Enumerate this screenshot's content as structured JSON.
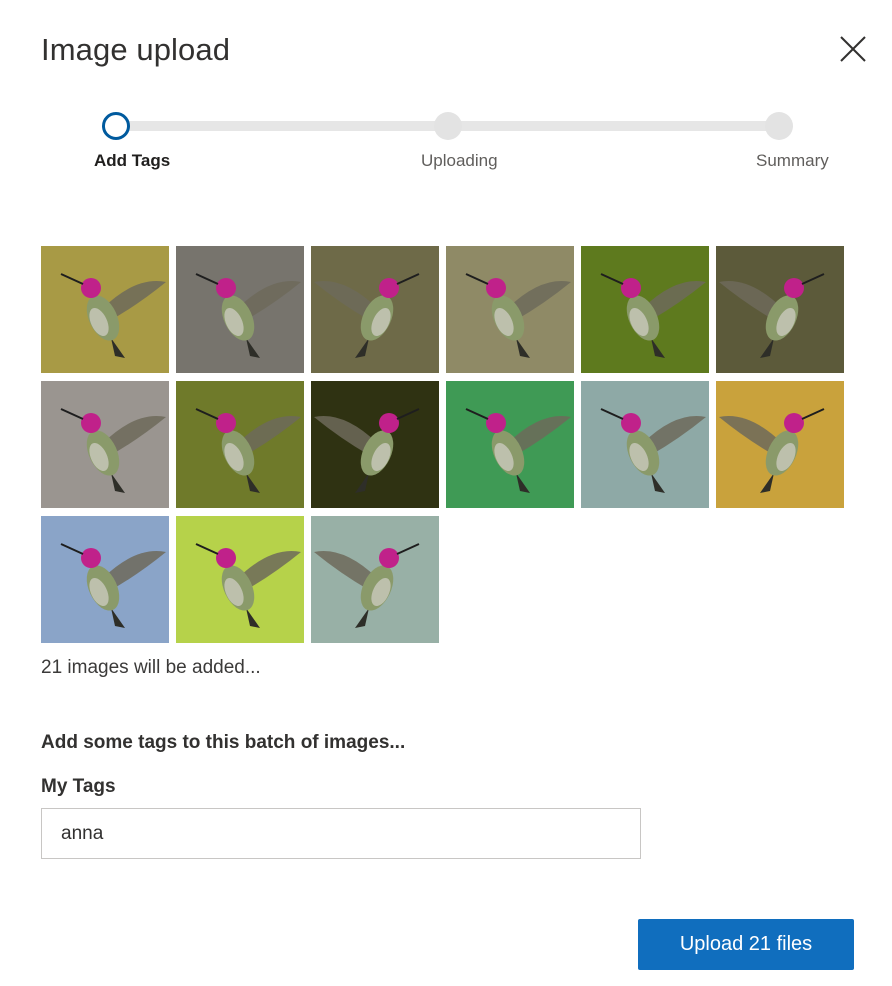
{
  "dialog": {
    "title": "Image upload",
    "close_icon": "close-icon"
  },
  "stepper": {
    "steps": [
      {
        "label": "Add Tags",
        "state": "active"
      },
      {
        "label": "Uploading",
        "state": "pending"
      },
      {
        "label": "Summary",
        "state": "pending"
      }
    ],
    "colors": {
      "active": "#005a9e",
      "track": "#e6e6e6",
      "pending": "#e3e3e3"
    }
  },
  "gallery": {
    "thumbnails": [
      {
        "subject": "hummingbird",
        "bg": "#a89a45"
      },
      {
        "subject": "hummingbird",
        "bg": "#77746d"
      },
      {
        "subject": "hummingbird",
        "bg": "#6e6a48"
      },
      {
        "subject": "hummingbird",
        "bg": "#8f8a66"
      },
      {
        "subject": "hummingbird",
        "bg": "#5e7a1e"
      },
      {
        "subject": "hummingbird",
        "bg": "#5c5a3a"
      },
      {
        "subject": "hummingbird",
        "bg": "#9a9590"
      },
      {
        "subject": "hummingbird",
        "bg": "#6f7a2a"
      },
      {
        "subject": "hummingbird",
        "bg": "#2f3212"
      },
      {
        "subject": "hummingbird",
        "bg": "#3f9a55"
      },
      {
        "subject": "hummingbird",
        "bg": "#8ea9a6"
      },
      {
        "subject": "hummingbird",
        "bg": "#c9a23c"
      },
      {
        "subject": "hummingbird",
        "bg": "#8aa4c8"
      },
      {
        "subject": "hummingbird",
        "bg": "#b6d24a"
      },
      {
        "subject": "hummingbird",
        "bg": "#98b0a6"
      }
    ],
    "count_text": "21 images will be added..."
  },
  "tags": {
    "heading": "Add some tags to this batch of images...",
    "field_label": "My Tags",
    "value": "anna"
  },
  "actions": {
    "upload_label": "Upload 21 files",
    "accent": "#106ebe"
  }
}
